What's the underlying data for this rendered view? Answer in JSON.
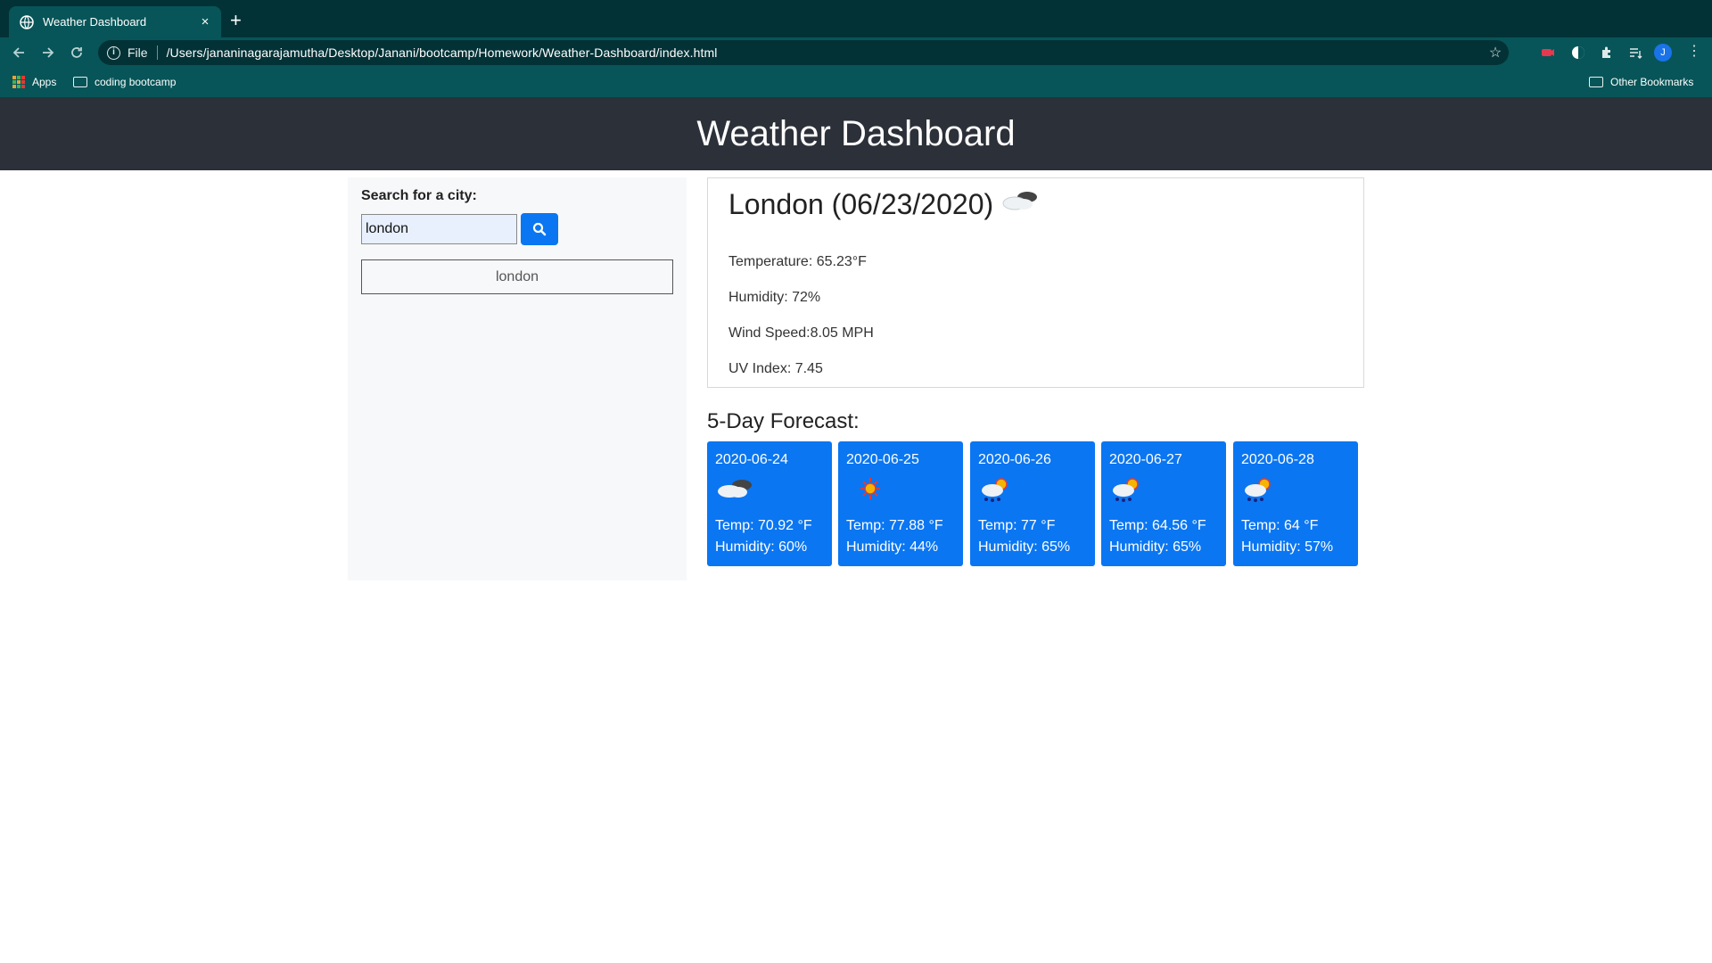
{
  "browser": {
    "tab_title": "Weather Dashboard",
    "tab_close": "×",
    "new_tab": "+",
    "omnibox_scheme": "File",
    "url": "/Users/jananinagarajamutha/Desktop/Janani/bootcamp/Homework/Weather-Dashboard/index.html",
    "avatar_letter": "J",
    "bookmarks": {
      "apps": "Apps",
      "folder": "coding bootcamp",
      "other": "Other Bookmarks"
    }
  },
  "page": {
    "title": "Weather Dashboard"
  },
  "search": {
    "label": "Search for a city:",
    "value": "london",
    "history": [
      "london"
    ]
  },
  "current": {
    "heading": "London (06/23/2020)",
    "icon": "cloud-icon",
    "temperature": "Temperature: 65.23°F",
    "humidity": "Humidity: 72%",
    "wind": "Wind Speed:8.05 MPH",
    "uv": "UV Index: 7.45"
  },
  "forecast": {
    "title": "5-Day Forecast:",
    "days": [
      {
        "date": "2020-06-24",
        "icon": "cloud-icon",
        "temp": "Temp: 70.92 °F",
        "humidity": "Humidity: 60%"
      },
      {
        "date": "2020-06-25",
        "icon": "sun-icon",
        "temp": "Temp: 77.88 °F",
        "humidity": "Humidity: 44%"
      },
      {
        "date": "2020-06-26",
        "icon": "sun-rain-cloud-icon",
        "temp": "Temp: 77 °F",
        "humidity": "Humidity: 65%"
      },
      {
        "date": "2020-06-27",
        "icon": "sun-rain-cloud-icon",
        "temp": "Temp: 64.56 °F",
        "humidity": "Humidity: 65%"
      },
      {
        "date": "2020-06-28",
        "icon": "sun-rain-cloud-icon",
        "temp": "Temp: 64 °F",
        "humidity": "Humidity: 57%"
      }
    ]
  },
  "colors": {
    "header_bg": "#2c3039",
    "card_bg": "#0a76f2",
    "chrome_dark": "#033236",
    "chrome_teal": "#075558"
  }
}
